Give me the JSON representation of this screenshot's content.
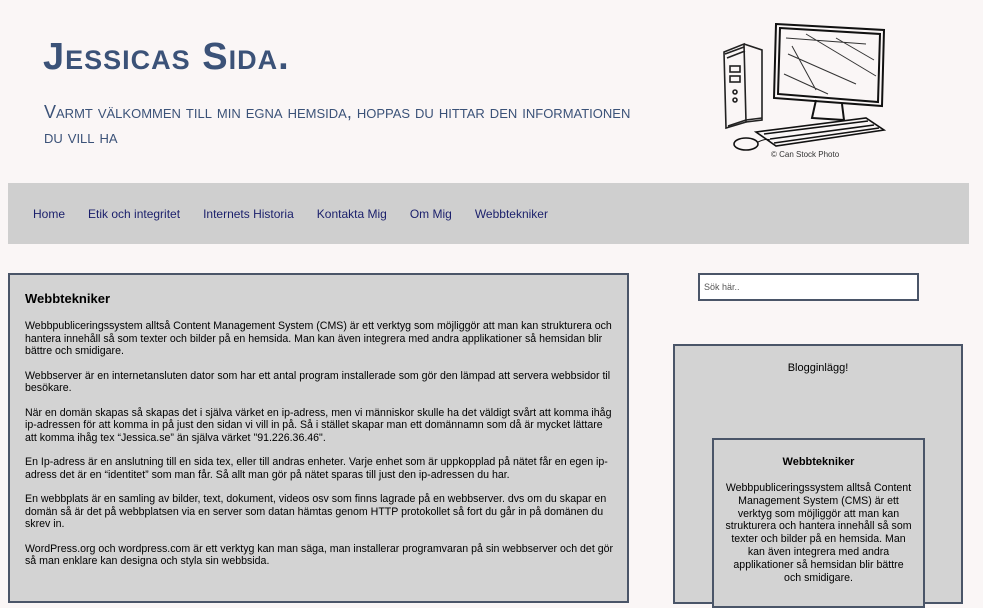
{
  "header": {
    "title": "Jessicas Sida.",
    "subtitle": "Varmt välkommen till min egna hemsida, hoppas du hittar den informationen du vill ha",
    "image_caption": "© Can Stock Photo"
  },
  "nav": {
    "items": [
      {
        "label": "Home"
      },
      {
        "label": "Etik och integritet"
      },
      {
        "label": "Internets Historia"
      },
      {
        "label": "Kontakta Mig"
      },
      {
        "label": "Om Mig"
      },
      {
        "label": "Webbtekniker"
      }
    ]
  },
  "main": {
    "heading": "Webbtekniker",
    "paragraphs": [
      "Webbpubliceringssystem alltså Content Management System (CMS) är ett verktyg som möjliggör att man kan strukturera och hantera innehåll så som texter och bilder på en hemsida. Man kan även integrera med andra applikationer så hemsidan blir bättre och smidigare.",
      "Webbserver är en internetansluten dator som har ett antal program installerade som gör den lämpad att servera webbsidor til besökare.",
      "När en domän skapas så skapas det i själva värket en ip-adress, men vi människor skulle ha det väldigt svårt att komma ihåg ip-adressen för att komma in på just den sidan vi vill in på. Så i stället skapar man ett domännamn som då är mycket lättare att komma ihåg tex “Jessica.se” än själva värket \"91.226.36.46\".",
      "En Ip-adress är en anslutning till en sida tex, eller till andras enheter. Varje enhet som är uppkopplad på nätet får en egen ip-adress det är en “identitet” som man får. Så allt man gör på nätet sparas till just den ip-adressen du har.",
      "En webbplats är en samling av bilder, text, dokument, videos osv som finns lagrade på en webbserver. dvs om du skapar en domän så är det på webbplatsen via en server som datan hämtas genom HTTP protokollet så fort du går in på domänen du skrev in.",
      "WordPress.org och wordpress.com är ett verktyg kan man säga, man installerar programvaran på sin webbserver och det gör så man enklare kan designa och styla sin webbsida."
    ]
  },
  "search": {
    "placeholder": "Sök här.."
  },
  "sidebar": {
    "title": "Blogginlägg!",
    "post": {
      "title": "Webbtekniker",
      "excerpt": "Webbpubliceringssystem alltså Content Management System (CMS) är ett verktyg som möjliggör att man kan strukturera och hantera innehåll så som texter och bilder på en hemsida. Man kan även integrera med andra applikationer så hemsidan blir bättre och smidigare."
    }
  }
}
